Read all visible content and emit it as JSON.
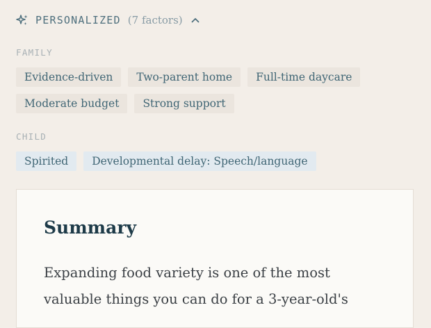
{
  "header": {
    "title": "PERSONALIZED",
    "count": "(7 factors)",
    "icon": "sparkle-icon",
    "toggle_icon": "chevron-up-icon"
  },
  "family": {
    "label": "FAMILY",
    "chips": [
      "Evidence-driven",
      "Two-parent home",
      "Full-time daycare",
      "Moderate budget",
      "Strong support"
    ]
  },
  "child": {
    "label": "CHILD",
    "chips": [
      "Spirited",
      "Developmental delay: Speech/language"
    ]
  },
  "summary": {
    "title": "Summary",
    "line1": "Expanding food variety is one of the most",
    "line2": "valuable things you can do for a 3-year-old's"
  },
  "colors": {
    "background": "#f3eee8",
    "accent_text": "#4e6f7d",
    "family_chip": "#ebe5de",
    "child_chip": "#e2eaf0",
    "card": "#fbfaf7",
    "heading": "#1d3a48"
  }
}
